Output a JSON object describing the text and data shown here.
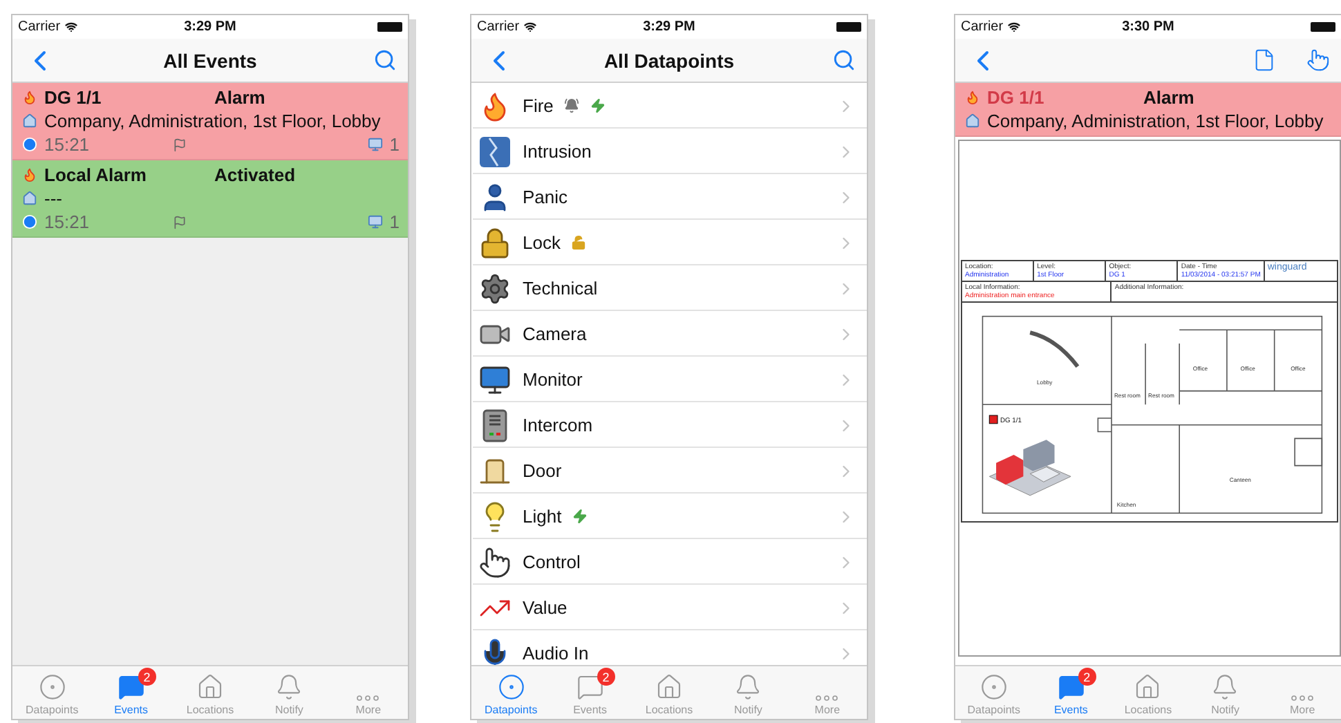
{
  "screens": [
    {
      "kind": "events",
      "status_bar": {
        "carrier": "Carrier",
        "time": "3:29 PM"
      },
      "nav": {
        "title": "All Events"
      },
      "events": [
        {
          "name": "DG 1/1",
          "state": "Alarm",
          "location": "Company, Administration, 1st Floor, Lobby",
          "time": "15:21",
          "count": "1",
          "color": "#f6a0a4"
        },
        {
          "name": "Local Alarm",
          "state": "Activated",
          "location": "---",
          "time": "15:21",
          "count": "1",
          "color": "#97d088"
        }
      ],
      "tabs": [
        {
          "label": "Datapoints",
          "selected": false
        },
        {
          "label": "Events",
          "selected": true,
          "badge": "2"
        },
        {
          "label": "Locations",
          "selected": false
        },
        {
          "label": "Notify",
          "selected": false
        },
        {
          "label": "More",
          "selected": false
        }
      ]
    },
    {
      "kind": "datapoints",
      "status_bar": {
        "carrier": "Carrier",
        "time": "3:29 PM"
      },
      "nav": {
        "title": "All Datapoints"
      },
      "items": [
        {
          "label": "Fire"
        },
        {
          "label": "Intrusion"
        },
        {
          "label": "Panic"
        },
        {
          "label": "Lock"
        },
        {
          "label": "Technical"
        },
        {
          "label": "Camera"
        },
        {
          "label": "Monitor"
        },
        {
          "label": "Intercom"
        },
        {
          "label": "Door"
        },
        {
          "label": "Light"
        },
        {
          "label": "Control"
        },
        {
          "label": "Value"
        },
        {
          "label": "Audio In"
        }
      ],
      "tabs": [
        {
          "label": "Datapoints",
          "selected": true
        },
        {
          "label": "Events",
          "selected": false,
          "badge": "2"
        },
        {
          "label": "Locations",
          "selected": false
        },
        {
          "label": "Notify",
          "selected": false
        },
        {
          "label": "More",
          "selected": false
        }
      ]
    },
    {
      "kind": "detail",
      "status_bar": {
        "carrier": "Carrier",
        "time": "3:30 PM"
      },
      "event": {
        "name": "DG 1/1",
        "faded": true,
        "state": "Alarm",
        "location": "Company, Administration, 1st Floor, Lobby",
        "color": "#f6a0a4"
      },
      "plan": {
        "header": [
          {
            "label": "Location:",
            "value": "Administration"
          },
          {
            "label": "Level:",
            "value": "1st Floor"
          },
          {
            "label": "Object:",
            "value": "DG 1"
          },
          {
            "label": "Date - Time",
            "value": "11/03/2014 - 03:21:57 PM"
          }
        ],
        "logo": "winguard",
        "local_label": "Local Information:",
        "local_value": "Administration main entrance",
        "additional_label": "Additional Information:",
        "rooms": [
          {
            "label": "Lobby"
          },
          {
            "label": "Office"
          },
          {
            "label": "Office"
          },
          {
            "label": "Office"
          },
          {
            "label": "Rest room"
          },
          {
            "label": "Rest room"
          },
          {
            "label": "Kitchen"
          },
          {
            "label": "Canteen"
          }
        ],
        "marker": {
          "label": "DG 1/1"
        }
      },
      "tabs": [
        {
          "label": "Datapoints",
          "selected": false
        },
        {
          "label": "Events",
          "selected": true,
          "badge": "2"
        },
        {
          "label": "Locations",
          "selected": false
        },
        {
          "label": "Notify",
          "selected": false
        },
        {
          "label": "More",
          "selected": false
        }
      ]
    }
  ]
}
